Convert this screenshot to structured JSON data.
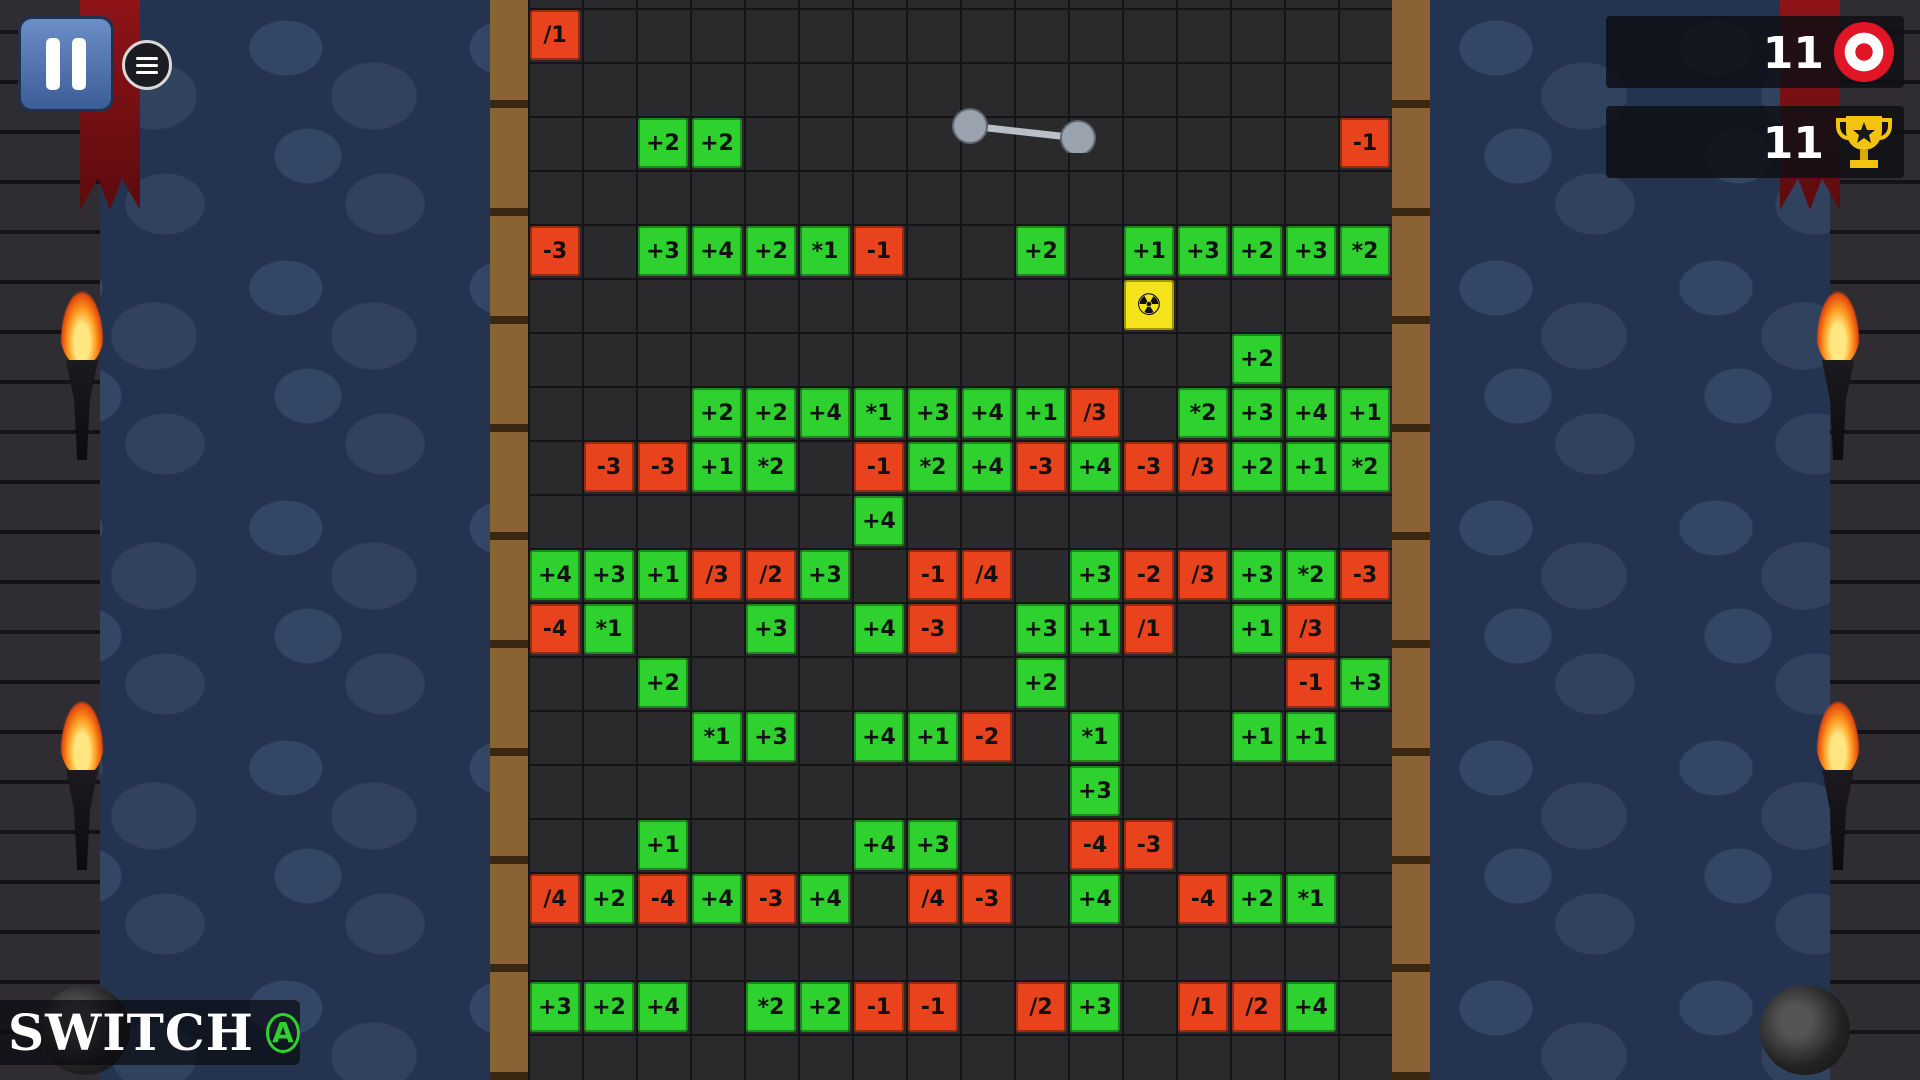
{
  "hud": {
    "target_score": "11",
    "target_icon": "target-icon",
    "best_score": "11",
    "best_icon": "trophy-icon",
    "switch_label": "SWITCH",
    "switch_button": "A"
  },
  "colors": {
    "positive": "#2fd12f",
    "negative": "#e8431c",
    "hazard": "#f4e21a"
  },
  "rows": [
    {
      "row": 1,
      "tiles": [
        [
          0,
          "/1",
          "red"
        ]
      ]
    },
    {
      "row": 3,
      "tiles": [
        [
          2,
          "+2",
          "green"
        ],
        [
          3,
          "+2",
          "green"
        ],
        [
          15,
          "-1",
          "red"
        ]
      ]
    },
    {
      "row": 5,
      "tiles": [
        [
          0,
          "-3",
          "red"
        ],
        [
          2,
          "+3",
          "green"
        ],
        [
          3,
          "+4",
          "green"
        ],
        [
          4,
          "+2",
          "green"
        ],
        [
          5,
          "*1",
          "green"
        ],
        [
          6,
          "-1",
          "red"
        ],
        [
          9,
          "+2",
          "green"
        ],
        [
          11,
          "+1",
          "green"
        ],
        [
          12,
          "+3",
          "green"
        ],
        [
          13,
          "+2",
          "green"
        ],
        [
          14,
          "+3",
          "green"
        ],
        [
          15,
          "*2",
          "green"
        ]
      ]
    },
    {
      "row": 6,
      "tiles": [
        [
          11,
          "☢",
          "hazard"
        ]
      ]
    },
    {
      "row": 7,
      "tiles": [
        [
          13,
          "+2",
          "green"
        ]
      ]
    },
    {
      "row": 8,
      "tiles": [
        [
          3,
          "+2",
          "green"
        ],
        [
          4,
          "+2",
          "green"
        ],
        [
          5,
          "+4",
          "green"
        ],
        [
          6,
          "*1",
          "green"
        ],
        [
          7,
          "+3",
          "green"
        ],
        [
          8,
          "+4",
          "green"
        ],
        [
          9,
          "+1",
          "green"
        ],
        [
          10,
          "/3",
          "red"
        ],
        [
          12,
          "*2",
          "green"
        ],
        [
          13,
          "+3",
          "green"
        ],
        [
          14,
          "+4",
          "green"
        ],
        [
          15,
          "+1",
          "green"
        ]
      ]
    },
    {
      "row": 9,
      "tiles": [
        [
          1,
          "-3",
          "red"
        ],
        [
          2,
          "-3",
          "red"
        ],
        [
          3,
          "+1",
          "green"
        ],
        [
          4,
          "*2",
          "green"
        ],
        [
          6,
          "-1",
          "red"
        ],
        [
          7,
          "*2",
          "green"
        ],
        [
          8,
          "+4",
          "green"
        ],
        [
          9,
          "-3",
          "red"
        ],
        [
          10,
          "+4",
          "green"
        ],
        [
          11,
          "-3",
          "red"
        ],
        [
          12,
          "/3",
          "red"
        ],
        [
          13,
          "+2",
          "green"
        ],
        [
          14,
          "+1",
          "green"
        ],
        [
          15,
          "*2",
          "green"
        ]
      ]
    },
    {
      "row": 10,
      "tiles": [
        [
          6,
          "+4",
          "green"
        ]
      ]
    },
    {
      "row": 11,
      "tiles": [
        [
          0,
          "+4",
          "green"
        ],
        [
          1,
          "+3",
          "green"
        ],
        [
          2,
          "+1",
          "green"
        ],
        [
          3,
          "/3",
          "red"
        ],
        [
          4,
          "/2",
          "red"
        ],
        [
          5,
          "+3",
          "green"
        ],
        [
          7,
          "-1",
          "red"
        ],
        [
          8,
          "/4",
          "red"
        ],
        [
          10,
          "+3",
          "green"
        ],
        [
          11,
          "-2",
          "red"
        ],
        [
          12,
          "/3",
          "red"
        ],
        [
          13,
          "+3",
          "green"
        ],
        [
          14,
          "*2",
          "green"
        ],
        [
          15,
          "-3",
          "red"
        ]
      ]
    },
    {
      "row": 12,
      "tiles": [
        [
          0,
          "-4",
          "red"
        ],
        [
          1,
          "*1",
          "green"
        ],
        [
          4,
          "+3",
          "green"
        ],
        [
          6,
          "+4",
          "green"
        ],
        [
          7,
          "-3",
          "red"
        ],
        [
          9,
          "+3",
          "green"
        ],
        [
          10,
          "+1",
          "green"
        ],
        [
          11,
          "/1",
          "red"
        ],
        [
          13,
          "+1",
          "green"
        ],
        [
          14,
          "/3",
          "red"
        ]
      ]
    },
    {
      "row": 13,
      "tiles": [
        [
          2,
          "+2",
          "green"
        ],
        [
          9,
          "+2",
          "green"
        ],
        [
          14,
          "-1",
          "red"
        ],
        [
          15,
          "+3",
          "green"
        ]
      ]
    },
    {
      "row": 14,
      "tiles": [
        [
          3,
          "*1",
          "green"
        ],
        [
          4,
          "+3",
          "green"
        ],
        [
          6,
          "+4",
          "green"
        ],
        [
          7,
          "+1",
          "green"
        ],
        [
          8,
          "-2",
          "red"
        ],
        [
          10,
          "*1",
          "green"
        ],
        [
          13,
          "+1",
          "green"
        ],
        [
          14,
          "+1",
          "green"
        ]
      ]
    },
    {
      "row": 15,
      "tiles": [
        [
          10,
          "+3",
          "green"
        ]
      ]
    },
    {
      "row": 16,
      "tiles": [
        [
          2,
          "+1",
          "green"
        ],
        [
          6,
          "+4",
          "green"
        ],
        [
          7,
          "+3",
          "green"
        ],
        [
          10,
          "-4",
          "red"
        ],
        [
          11,
          "-3",
          "red"
        ]
      ]
    },
    {
      "row": 17,
      "tiles": [
        [
          0,
          "/4",
          "red"
        ],
        [
          1,
          "+2",
          "green"
        ],
        [
          2,
          "-4",
          "red"
        ],
        [
          3,
          "+4",
          "green"
        ],
        [
          4,
          "-3",
          "red"
        ],
        [
          5,
          "+4",
          "green"
        ],
        [
          7,
          "/4",
          "red"
        ],
        [
          8,
          "-3",
          "red"
        ],
        [
          10,
          "+4",
          "green"
        ],
        [
          12,
          "-4",
          "red"
        ],
        [
          13,
          "+2",
          "green"
        ],
        [
          14,
          "*1",
          "green"
        ]
      ]
    },
    {
      "row": 19,
      "tiles": [
        [
          0,
          "+3",
          "green"
        ],
        [
          1,
          "+2",
          "green"
        ],
        [
          2,
          "+4",
          "green"
        ],
        [
          4,
          "*2",
          "green"
        ],
        [
          5,
          "+2",
          "green"
        ],
        [
          6,
          "-1",
          "red"
        ],
        [
          7,
          "-1",
          "red"
        ],
        [
          9,
          "/2",
          "red"
        ],
        [
          10,
          "+3",
          "green"
        ],
        [
          12,
          "/1",
          "red"
        ],
        [
          13,
          "/2",
          "red"
        ],
        [
          14,
          "+4",
          "green"
        ]
      ]
    }
  ]
}
